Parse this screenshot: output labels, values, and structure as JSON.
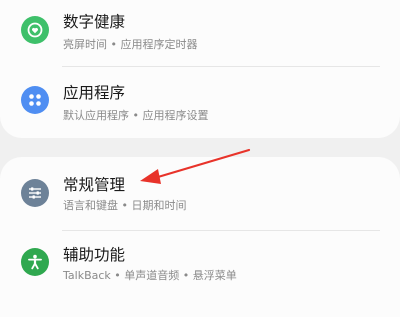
{
  "items": [
    {
      "title": "数字健康",
      "subtitle": "亮屏时间 • 应用程序定时器",
      "icon": "heart-circle-icon",
      "color": "#3ec06a"
    },
    {
      "title": "应用程序",
      "subtitle": "默认应用程序 • 应用程序设置",
      "icon": "apps-grid-icon",
      "color": "#4f8ef2"
    },
    {
      "title": "常规管理",
      "subtitle": "语言和键盘 • 日期和时间",
      "icon": "sliders-icon",
      "color": "#6d8298"
    },
    {
      "title": "辅助功能",
      "subtitle": "TalkBack • 单声道音频 • 悬浮菜单",
      "icon": "accessibility-person-icon",
      "color": "#2fa84f"
    }
  ],
  "annotation": {
    "color": "#e8332a"
  }
}
